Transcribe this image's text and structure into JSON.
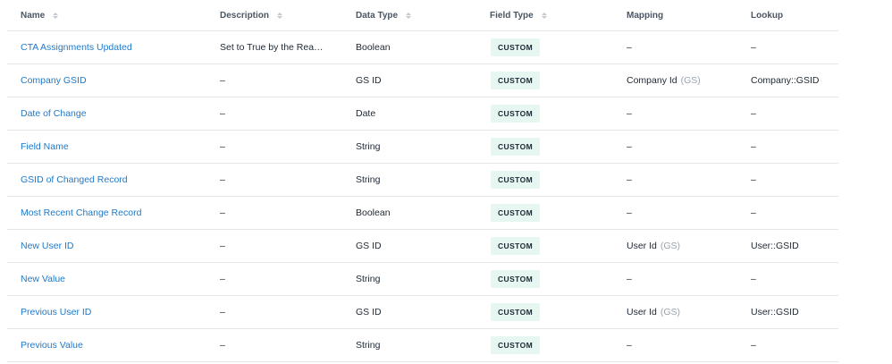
{
  "columns": {
    "name": "Name",
    "description": "Description",
    "data_type": "Data Type",
    "field_type": "Field Type",
    "mapping": "Mapping",
    "lookup": "Lookup"
  },
  "rows": [
    {
      "name": "CTA Assignments Updated",
      "description": "Set to True by the Rea…",
      "data_type": "Boolean",
      "field_type": "CUSTOM",
      "mapping": "–",
      "mapping_suffix": "",
      "lookup": "–"
    },
    {
      "name": "Company GSID",
      "description": "–",
      "data_type": "GS ID",
      "field_type": "CUSTOM",
      "mapping": "Company Id",
      "mapping_suffix": "(GS)",
      "lookup": "Company::GSID"
    },
    {
      "name": "Date of Change",
      "description": "–",
      "data_type": "Date",
      "field_type": "CUSTOM",
      "mapping": "–",
      "mapping_suffix": "",
      "lookup": "–"
    },
    {
      "name": "Field Name",
      "description": "–",
      "data_type": "String",
      "field_type": "CUSTOM",
      "mapping": "–",
      "mapping_suffix": "",
      "lookup": "–"
    },
    {
      "name": "GSID of Changed Record",
      "description": "–",
      "data_type": "String",
      "field_type": "CUSTOM",
      "mapping": "–",
      "mapping_suffix": "",
      "lookup": "–"
    },
    {
      "name": "Most Recent Change Record",
      "description": "–",
      "data_type": "Boolean",
      "field_type": "CUSTOM",
      "mapping": "–",
      "mapping_suffix": "",
      "lookup": "–"
    },
    {
      "name": "New User ID",
      "description": "–",
      "data_type": "GS ID",
      "field_type": "CUSTOM",
      "mapping": "User Id",
      "mapping_suffix": "(GS)",
      "lookup": "User::GSID"
    },
    {
      "name": "New Value",
      "description": "–",
      "data_type": "String",
      "field_type": "CUSTOM",
      "mapping": "–",
      "mapping_suffix": "",
      "lookup": "–"
    },
    {
      "name": "Previous User ID",
      "description": "–",
      "data_type": "GS ID",
      "field_type": "CUSTOM",
      "mapping": "User Id",
      "mapping_suffix": "(GS)",
      "lookup": "User::GSID"
    },
    {
      "name": "Previous Value",
      "description": "–",
      "data_type": "String",
      "field_type": "CUSTOM",
      "mapping": "–",
      "mapping_suffix": "",
      "lookup": "–"
    }
  ],
  "icons": {
    "sort": "sort-icon"
  },
  "colors": {
    "link": "#1f79c9",
    "badge_bg": "#e6f6f0",
    "divider": "#e3e6ea"
  }
}
